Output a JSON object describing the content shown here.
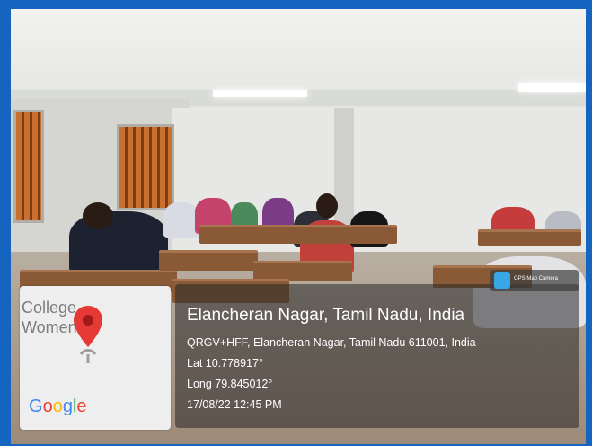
{
  "map_card": {
    "text_line1": "College",
    "text_line2": "Women",
    "google_letters": [
      {
        "ch": "G",
        "color": "#4285f4"
      },
      {
        "ch": "o",
        "color": "#ea4335"
      },
      {
        "ch": "o",
        "color": "#fbbc05"
      },
      {
        "ch": "g",
        "color": "#4285f4"
      },
      {
        "ch": "l",
        "color": "#34a853"
      },
      {
        "ch": "e",
        "color": "#ea4335"
      }
    ],
    "pin_icon": "map-pin-icon",
    "pin_color": "#e53935"
  },
  "badge": {
    "label": "GPS Map Camera",
    "icon": "gps-map-camera-icon"
  },
  "location": {
    "title": "Elancheran Nagar, Tamil Nadu, India",
    "address": "QRGV+HFF, Elancheran Nagar, Tamil Nadu 611001, India",
    "lat": "Lat 10.778917°",
    "long": "Long 79.845012°",
    "datetime": "17/08/22 12:45 PM"
  },
  "colors": {
    "frame_border": "#1565c0",
    "overlay": "rgba(40,40,40,0.55)"
  }
}
